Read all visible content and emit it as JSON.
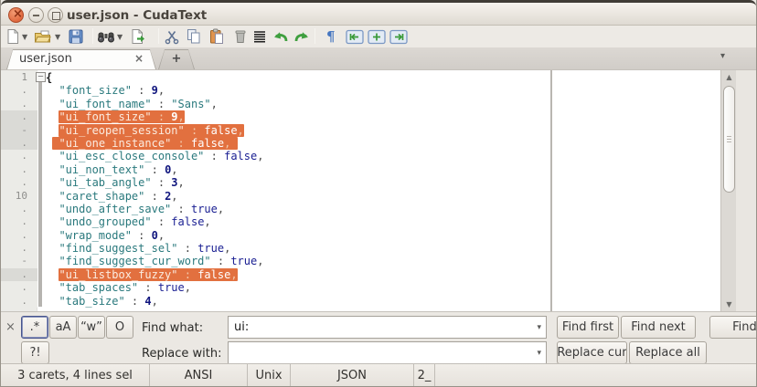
{
  "window": {
    "title": "user.json - CudaText",
    "buttons": [
      "close",
      "minimize",
      "maximize"
    ]
  },
  "toolbar": {
    "icons": [
      "new-file",
      "new-file-menu",
      "open-file",
      "open-file-menu",
      "save-file",
      "find-dialog",
      "find-menu",
      "run-tool",
      "cut",
      "copy",
      "paste",
      "delete",
      "select-all",
      "undo",
      "redo",
      "pilcrow-toggle",
      "unfold-left",
      "fold-block",
      "unfold-right"
    ]
  },
  "tabs": {
    "items": [
      {
        "label": "user.json",
        "close": "×"
      }
    ],
    "new_tab": "+",
    "menu_icon": "▾"
  },
  "editor": {
    "lines": [
      {
        "g": "1",
        "text": "{",
        "fold": true
      },
      {
        "g": ".",
        "k": "font_size",
        "v": "9",
        "vt": "num"
      },
      {
        "g": ".",
        "k": "ui_font_name",
        "v": "\"Sans\"",
        "vt": "str"
      },
      {
        "g": ".",
        "k": "ui_font_size",
        "v": "9",
        "vt": "num",
        "sel": true
      },
      {
        "g": "-",
        "k": "ui_reopen_session",
        "v": "false",
        "vt": "kw",
        "sel": true
      },
      {
        "g": ".",
        "k": "ui_one_instance",
        "v": "false",
        "vt": "kw",
        "sel": true,
        "selpre": true,
        "selpost": true
      },
      {
        "g": ".",
        "k": "ui_esc_close_console",
        "v": "false",
        "vt": "kw"
      },
      {
        "g": ".",
        "k": "ui_non_text",
        "v": "0",
        "vt": "num"
      },
      {
        "g": ".",
        "k": "ui_tab_angle",
        "v": "3",
        "vt": "num"
      },
      {
        "g": "10",
        "k": "caret_shape",
        "v": "2",
        "vt": "num"
      },
      {
        "g": ".",
        "k": "undo_after_save",
        "v": "true",
        "vt": "kw"
      },
      {
        "g": ".",
        "k": "undo_grouped",
        "v": "false",
        "vt": "kw"
      },
      {
        "g": ".",
        "k": "wrap_mode",
        "v": "0",
        "vt": "num"
      },
      {
        "g": ".",
        "k": "find_suggest_sel",
        "v": "true",
        "vt": "kw"
      },
      {
        "g": "-",
        "k": "find_suggest_cur_word",
        "v": "true",
        "vt": "kw"
      },
      {
        "g": ".",
        "k": "ui_listbox_fuzzy",
        "v": "false",
        "vt": "kw",
        "sel": true
      },
      {
        "g": ".",
        "k": "tab_spaces",
        "v": "true",
        "vt": "kw"
      },
      {
        "g": ".",
        "k": "tab_size",
        "v": "4",
        "vt": "num"
      }
    ]
  },
  "find": {
    "close_label": "×",
    "options": [
      ".*",
      "aA",
      "“w”",
      "O"
    ],
    "options_row2": [
      "?!"
    ],
    "find_label": "Find what:",
    "replace_label": "Replace with:",
    "find_value": "ui:",
    "replace_value": "",
    "buttons_row1": [
      "Find first",
      "Find next",
      "Find prev"
    ],
    "buttons_row2": [
      "Replace cur",
      "Replace all"
    ],
    "combo_arrow": "▾"
  },
  "status": {
    "cells": [
      "3 carets, 4 lines sel",
      "ANSI",
      "Unix",
      "JSON",
      "2_",
      ""
    ]
  },
  "colors": {
    "selection": "#E2703F",
    "key": "#2a797d",
    "value": "#1b2093",
    "number": "#10157e"
  }
}
